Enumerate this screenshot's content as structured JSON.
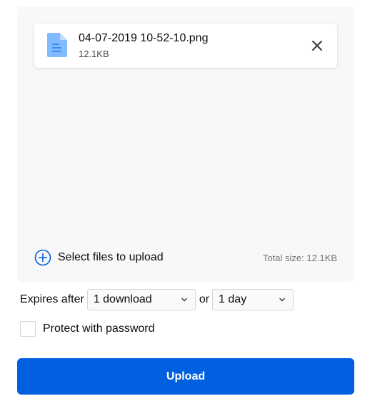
{
  "file": {
    "name": "04-07-2019 10-52-10.png",
    "size": "12.1KB",
    "icon": "document-icon"
  },
  "upload_area": {
    "select_label": "Select files to upload",
    "total_size": "Total size: 12.1KB"
  },
  "options": {
    "expires_label": "Expires after",
    "downloads_value": "1 download",
    "or_label": "or",
    "time_value": "1 day",
    "password_label": "Protect with password",
    "password_checked": false
  },
  "upload_button": {
    "label": "Upload"
  },
  "colors": {
    "accent": "#0060df",
    "file_icon": "#80bbff",
    "upload_area_bg": "#f8f8f8"
  }
}
